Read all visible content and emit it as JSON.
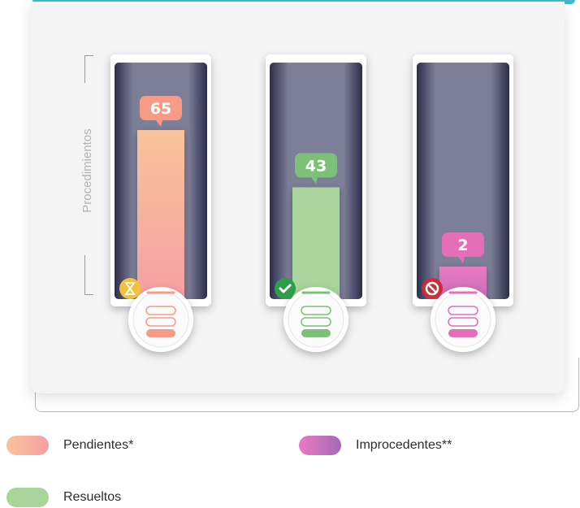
{
  "chart_data": {
    "type": "bar",
    "ylabel": "Procedimientos",
    "ylim": [
      0,
      100
    ],
    "categories": [
      "Pendientes*",
      "Resueltos",
      "Improcedentes**"
    ],
    "values": [
      65,
      43,
      2
    ],
    "colors": [
      [
        "#f9c39a",
        "#f4a0a4"
      ],
      [
        "#a9d49b",
        "#a9d49b"
      ],
      [
        "#ea7ac4",
        "#c66db5"
      ]
    ],
    "badge_colors": [
      "#f89b86",
      "#7dc077",
      "#e46fb8"
    ],
    "status_icons": [
      "hourglass-icon",
      "checkmark-icon",
      "prohibited-icon"
    ],
    "status_icon_colors": [
      "#f3c23c",
      "#2f9e4b",
      "#cc2d3a"
    ]
  },
  "legend": [
    {
      "label": "Pendientes*",
      "color_from": "#f9c39a",
      "color_to": "#f4a0a4"
    },
    {
      "label": "Improcedentes**",
      "color_from": "#ea7ac4",
      "color_to": "#a36bb6"
    },
    {
      "label": "Resueltos",
      "color_from": "#a9d49b",
      "color_to": "#a9d49b"
    }
  ]
}
